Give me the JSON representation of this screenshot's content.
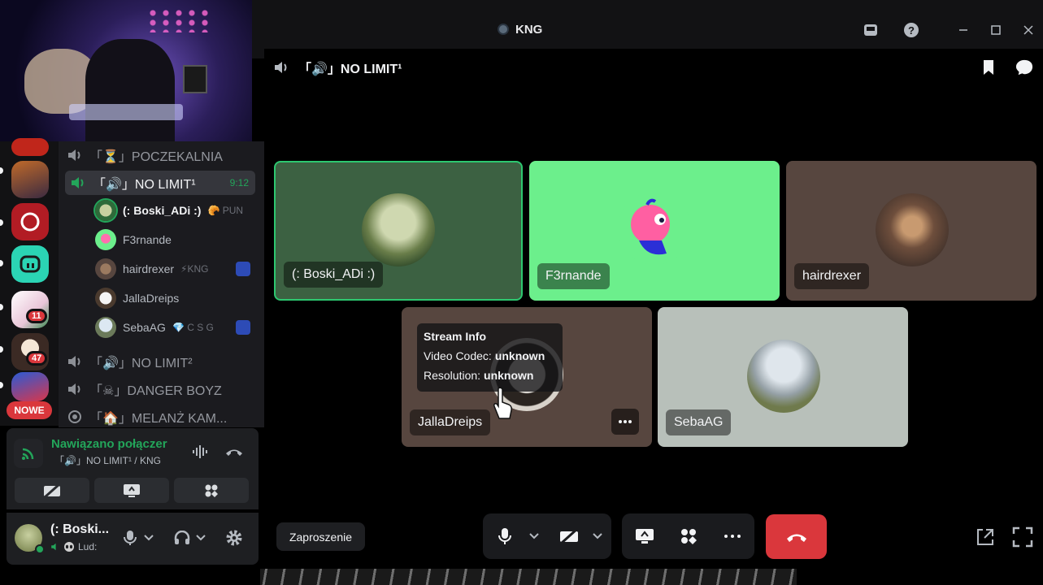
{
  "window": {
    "title": "KNG",
    "icons": [
      "inbox-icon",
      "help-icon",
      "minimize-icon",
      "maximize-icon",
      "close-icon"
    ]
  },
  "header": {
    "channel_name": "「🔊」NO LIMIT¹"
  },
  "server_rail": {
    "badges": [
      "11",
      "47"
    ],
    "new_label": "NOWE"
  },
  "channels": [
    {
      "name": "「⏳」POCZEKALNIA",
      "icon": "voice-channel-icon"
    },
    {
      "name": "「🔊」NO LIMIT¹",
      "icon": "voice-channel-icon",
      "active": true,
      "timer": "9:12"
    },
    {
      "name": "「🔊」NO LIMIT²",
      "icon": "voice-channel-icon"
    },
    {
      "name": "「☠」DANGER BOYZ",
      "icon": "voice-channel-icon"
    },
    {
      "name": "「🏠」MELANŻ KAM...",
      "icon": "stage-channel-icon"
    }
  ],
  "members": [
    {
      "name": "(: Boski_ADi :)",
      "tag": "🥐 PUN"
    },
    {
      "name": "F3rnande",
      "tag": ""
    },
    {
      "name": "hairdrexer",
      "tag": "⚡KNG"
    },
    {
      "name": "JallaDreips",
      "tag": ""
    },
    {
      "name": "SebaAG",
      "tag": "💎 C S G"
    }
  ],
  "voice_panel": {
    "status": "Nawiązano połączer",
    "channel": "「🔊」NO LIMIT¹ / KNG"
  },
  "user_panel": {
    "name": "(: Boski...",
    "sub": "Lud:"
  },
  "tiles": [
    {
      "name": "(: Boski_ADi :)"
    },
    {
      "name": "F3rnande"
    },
    {
      "name": "hairdrexer"
    },
    {
      "name": "JallaDreips"
    },
    {
      "name": "SebaAG"
    }
  ],
  "stream_info": {
    "title": "Stream Info",
    "codec_label": "Video Codec:",
    "codec_value": "unknown",
    "resolution_label": "Resolution:",
    "resolution_value": "unknown"
  },
  "controls": {
    "invite_label": "Zaproszenie"
  },
  "colors": {
    "accent_green": "#23a55a",
    "hangup_red": "#da373c",
    "speaking_border": "#2dc770"
  }
}
